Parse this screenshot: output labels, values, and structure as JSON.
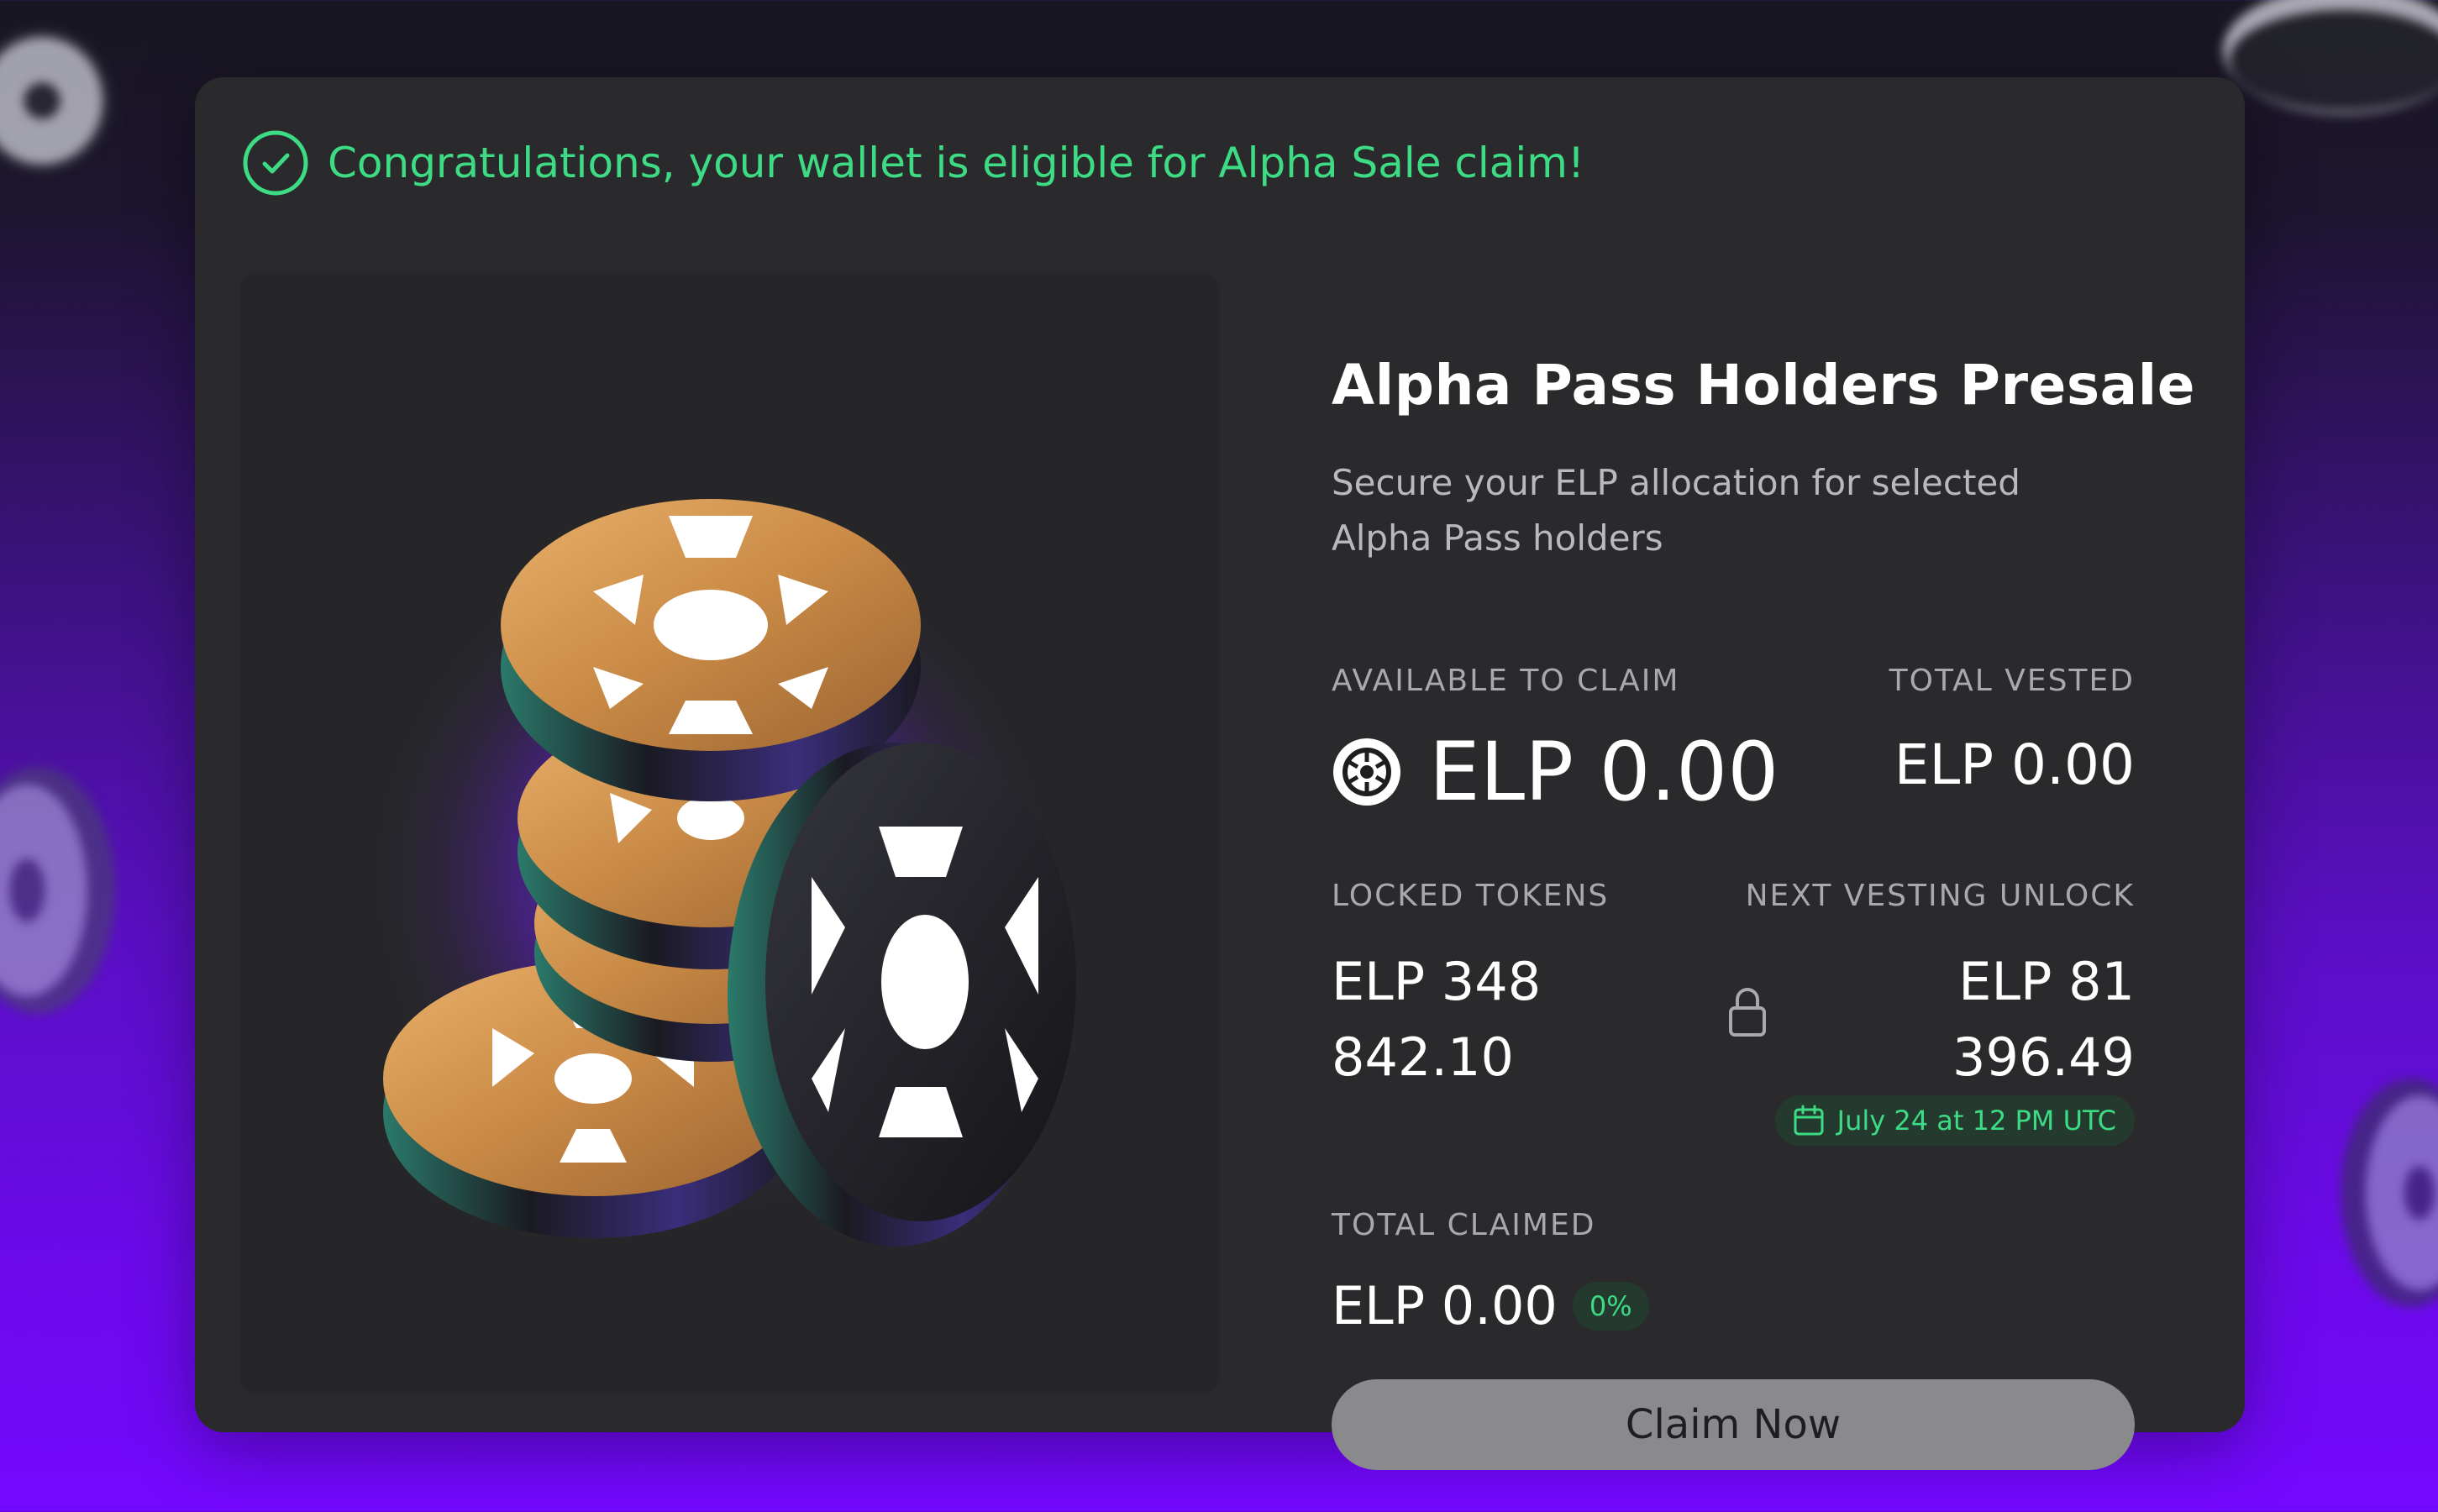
{
  "banner": {
    "icon": "check-circle-icon",
    "text": "Congratulations, your wallet is eligible for Alpha Sale claim!"
  },
  "presale": {
    "title": "Alpha Pass Holders Presale",
    "subtitle": "Secure your ELP allocation for selected Alpha Pass holders"
  },
  "stats": {
    "available": {
      "label": "AVAILABLE TO CLAIM",
      "value": "ELP 0.00",
      "icon": "elp-token-icon"
    },
    "vested": {
      "label": "TOTAL VESTED",
      "value": "ELP 0.00"
    },
    "locked": {
      "label": "LOCKED TOKENS",
      "value": "ELP 348 842.10"
    },
    "next_unlock": {
      "label": "NEXT VESTING UNLOCK",
      "value": "ELP 81 396.49",
      "date": "July 24 at 12 PM UTC",
      "icon": "calendar-icon"
    },
    "claimed": {
      "label": "TOTAL CLAIMED",
      "value": "ELP 0.00",
      "percent": "0%"
    }
  },
  "lock_icon": "lock-icon",
  "claim_button": {
    "label": "Claim Now"
  },
  "colors": {
    "accent_green": "#3ddc84",
    "card_bg": "#2a2a2c",
    "button_bg": "#8a8a8c",
    "background_purple": "#6b0ae8"
  }
}
